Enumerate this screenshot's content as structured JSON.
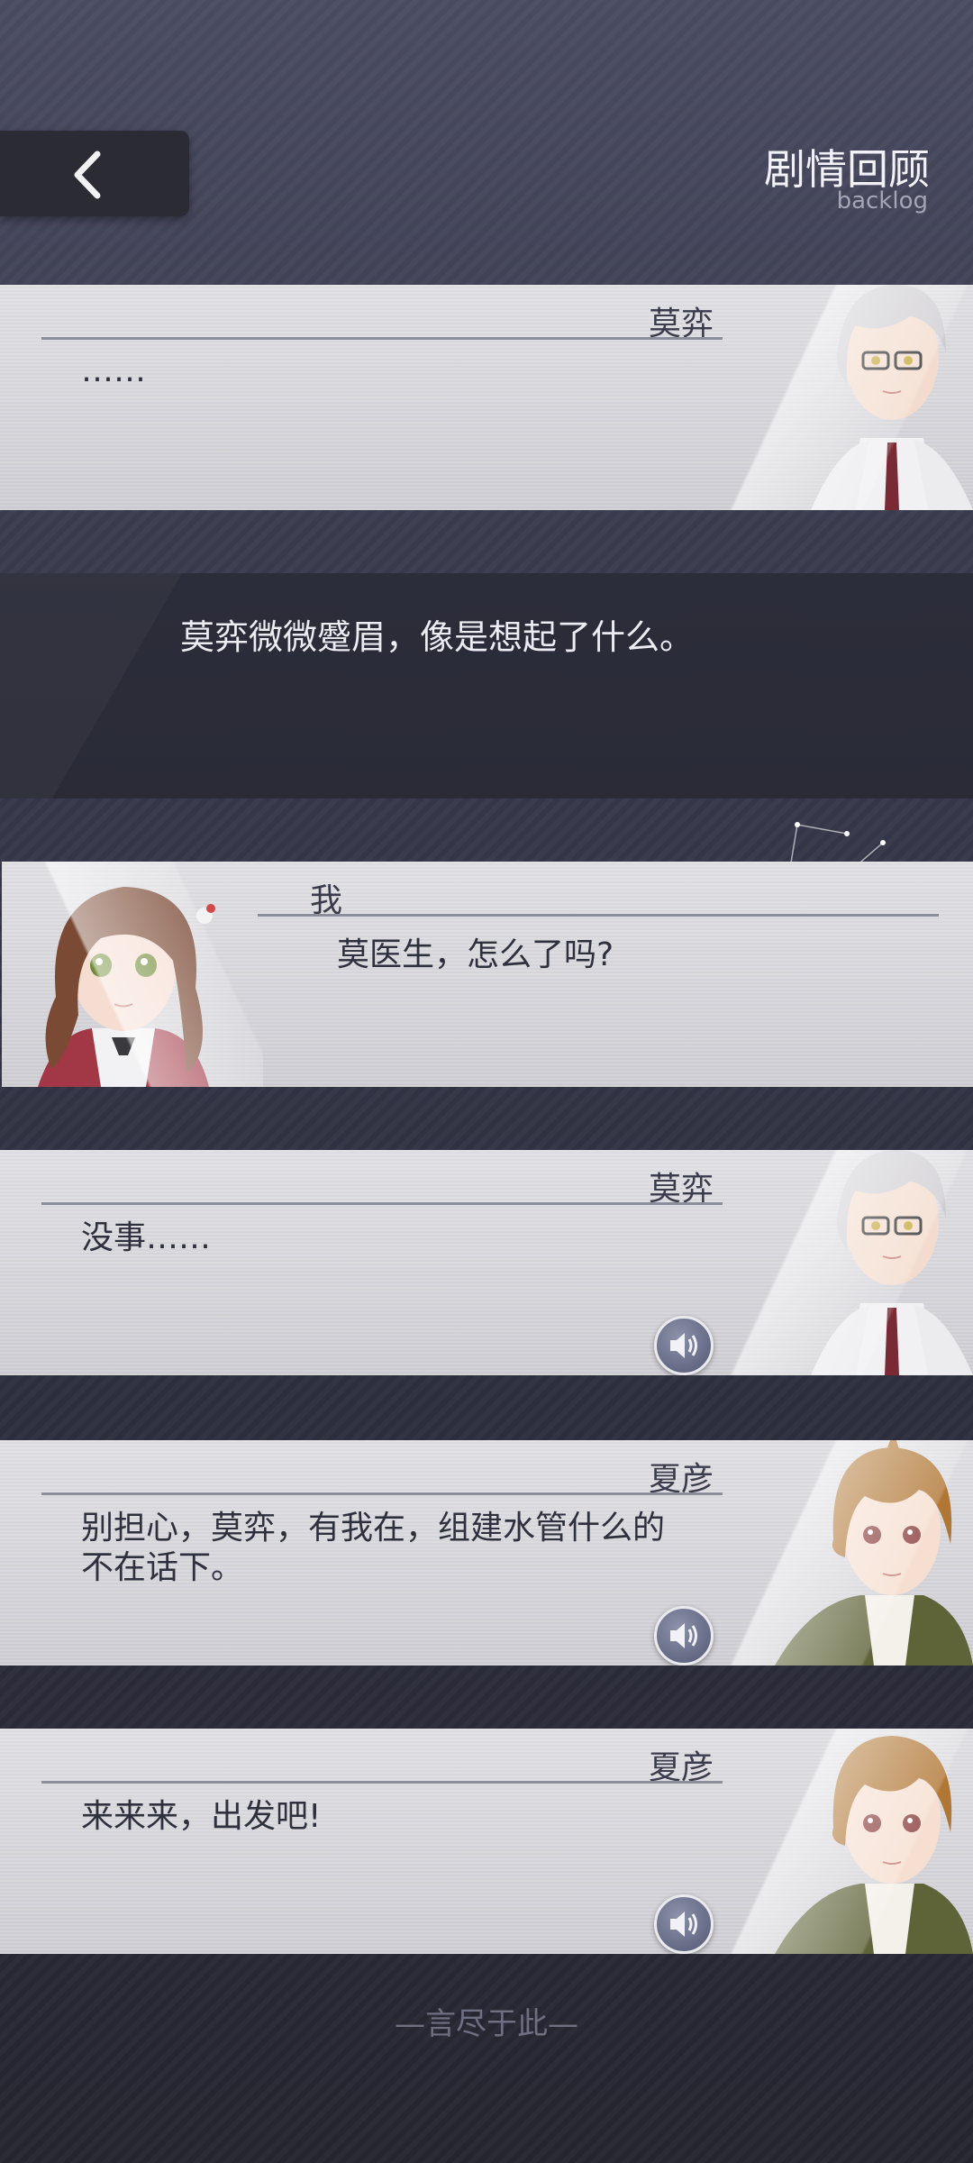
{
  "header": {
    "title": "剧情回顾",
    "subtitle": "backlog"
  },
  "entries": [
    {
      "speaker": "莫弈",
      "text": "……",
      "has_voice": false
    },
    {
      "speaker": "",
      "text": "莫弈微微蹙眉，像是想起了什么。",
      "type": "narration"
    },
    {
      "speaker": "我",
      "text": "莫医生，怎么了吗?",
      "has_voice": false
    },
    {
      "speaker": "莫弈",
      "text": "没事……",
      "has_voice": true
    },
    {
      "speaker": "夏彦",
      "text_line1": "别担心，莫弈，有我在，组建水管什么的",
      "text_line2": "不在话下。",
      "has_voice": true
    },
    {
      "speaker": "夏彦",
      "text": "来来来，出发吧!",
      "has_voice": true
    }
  ],
  "footer": {
    "end_text": "—言尽于此—"
  },
  "colors": {
    "background": "#34354a",
    "card": "#d6d6db",
    "narration_band": "#2b2c39",
    "back_button": "#2b2c33",
    "sound_button": "#6a7090"
  },
  "icons": [
    "back-arrow-icon",
    "speaker-icon",
    "portrait-moyi",
    "portrait-heroine",
    "portrait-xiayan"
  ]
}
